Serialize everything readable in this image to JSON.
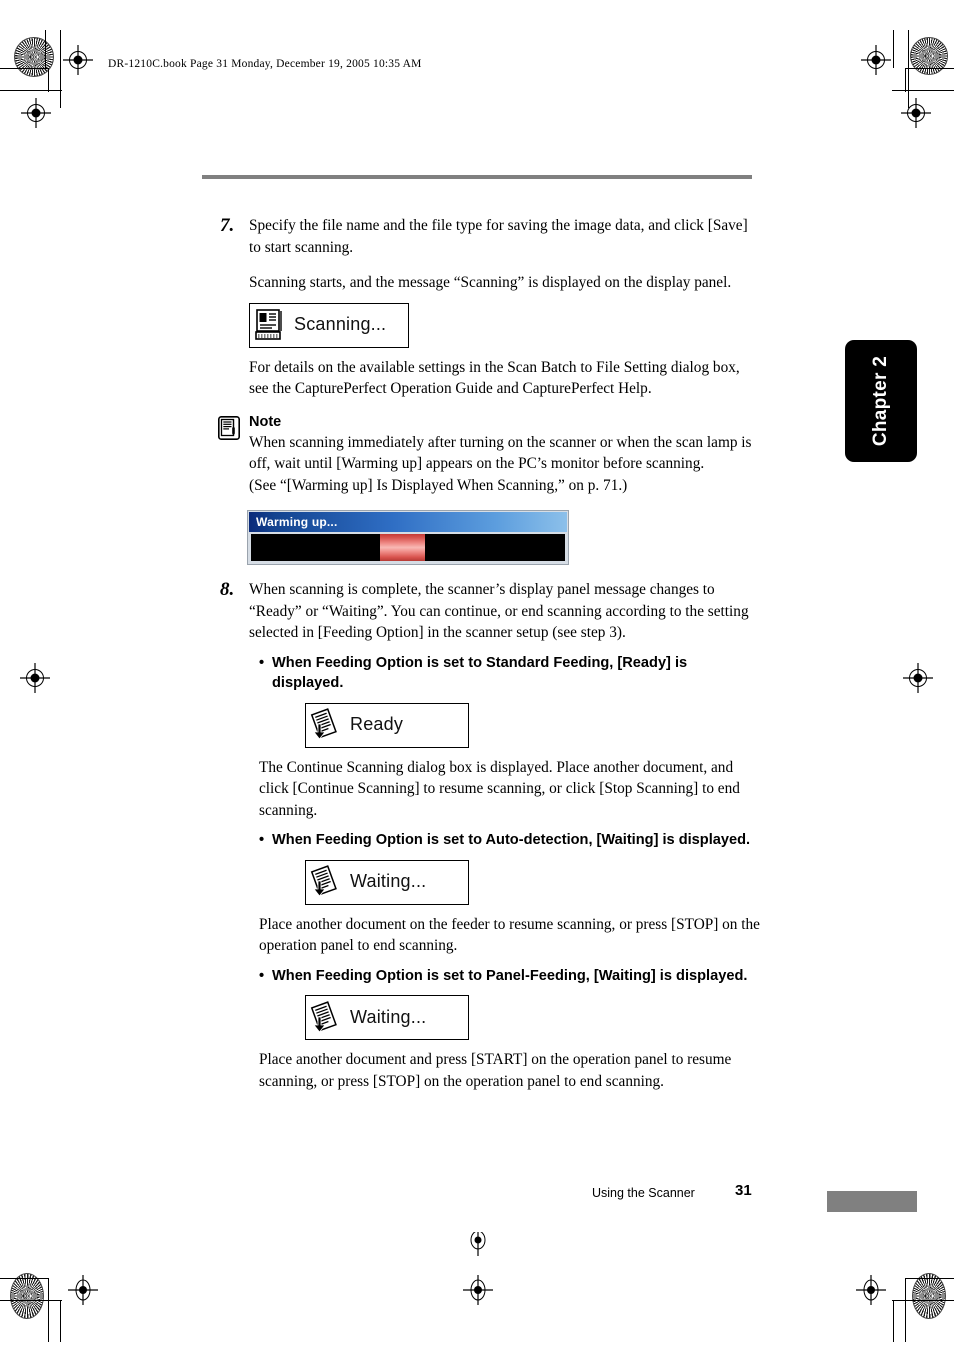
{
  "header": {
    "book_line": "DR-1210C.book  Page 31  Monday, December 19, 2005  10:35 AM"
  },
  "chapter_tab": {
    "label": "Chapter 2"
  },
  "footer": {
    "section_title": "Using the Scanner",
    "page_number": "31"
  },
  "steps": [
    {
      "number": "7.",
      "paragraphs": [
        "Specify the file name and the file type for saving the image data, and click [Save] to start scanning.",
        "Scanning starts, and the message “Scanning” is displayed on the display panel."
      ],
      "lcd": {
        "icon": "scanner-document-icon",
        "text": "Scanning..."
      },
      "after": "For details on the available settings in the Scan Batch to File Setting dialog box, see the CapturePerfect Operation Guide and CapturePerfect Help."
    },
    {
      "number": "8.",
      "paragraphs": [
        "When scanning is complete, the scanner’s display panel message changes to “Ready” or “Waiting”. You can continue, or end scanning according to the setting selected in [Feeding Option] in the scanner setup (see step 3)."
      ]
    }
  ],
  "note": {
    "icon": "note-document-icon",
    "title": "Note",
    "lines": [
      "When scanning immediately after turning on the scanner or when the scan lamp is off, wait until [Warming up] appears on the PC’s monitor before scanning.",
      "(See “[Warming up] Is Displayed When Scanning,” on p. 71.)"
    ]
  },
  "warming_dialog": {
    "title": "Warming up...",
    "progress_color": "#e8736d",
    "titlebar_color": "#0a2a7a",
    "track_color": "#000000"
  },
  "bullets": [
    {
      "bullet_char": "•",
      "heading": "When Feeding Option is set to Standard Feeding, [Ready] is displayed.",
      "lcd": {
        "icon": "document-feed-arrow-icon",
        "text": "Ready"
      },
      "body": "The Continue Scanning dialog box is displayed. Place another document, and click [Continue Scanning] to resume scanning, or click [Stop Scanning] to end scanning."
    },
    {
      "bullet_char": "•",
      "heading": "When Feeding Option is set to Auto-detection, [Waiting] is displayed.",
      "lcd": {
        "icon": "document-feed-arrow-icon",
        "text": "Waiting..."
      },
      "body": "Place another document on the feeder to resume scanning, or press [STOP] on the operation panel to end scanning."
    },
    {
      "bullet_char": "•",
      "heading": "When Feeding Option is set to Panel-Feeding, [Waiting] is displayed.",
      "lcd": {
        "icon": "document-feed-arrow-icon",
        "text": "Waiting..."
      },
      "body": "Place another document and press [START] on the operation panel to resume scanning, or press [STOP] on the operation panel to end scanning."
    }
  ]
}
